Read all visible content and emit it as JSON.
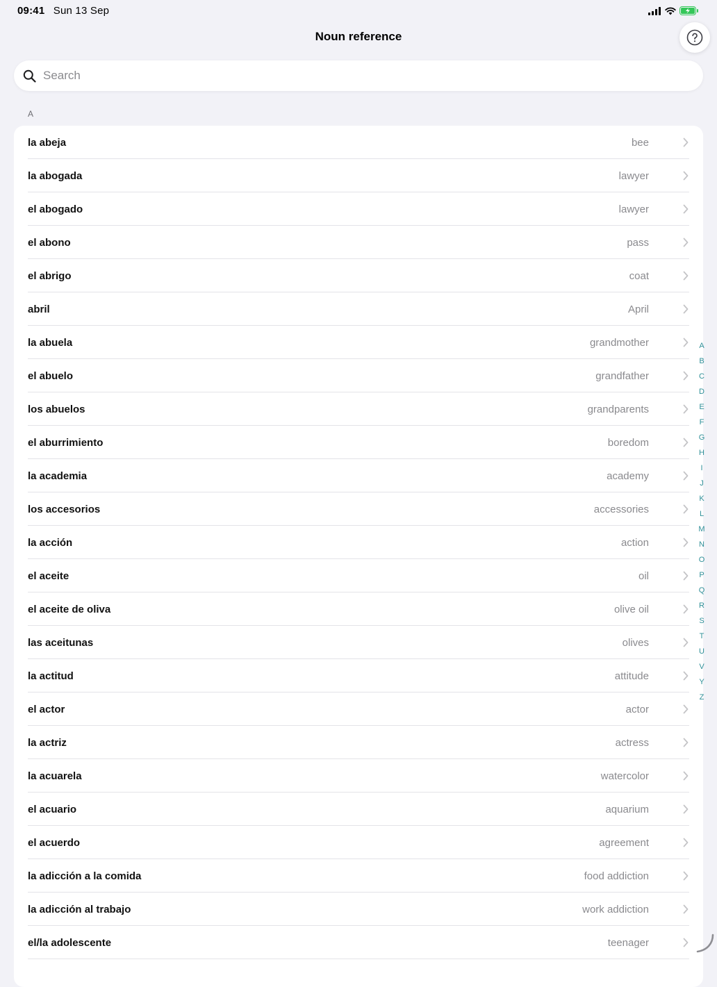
{
  "status": {
    "time": "09:41",
    "date": "Sun 13 Sep",
    "battery_color": "#34c759"
  },
  "nav": {
    "title": "Noun reference",
    "help_icon": "question-circle-icon"
  },
  "search": {
    "placeholder": "Search",
    "value": ""
  },
  "section": {
    "header": "A"
  },
  "rows": [
    {
      "term": "la abeja",
      "translation": "bee"
    },
    {
      "term": "la abogada",
      "translation": "lawyer"
    },
    {
      "term": "el abogado",
      "translation": "lawyer"
    },
    {
      "term": "el abono",
      "translation": "pass"
    },
    {
      "term": "el abrigo",
      "translation": "coat"
    },
    {
      "term": "abril",
      "translation": "April"
    },
    {
      "term": "la abuela",
      "translation": "grandmother"
    },
    {
      "term": "el abuelo",
      "translation": "grandfather"
    },
    {
      "term": "los abuelos",
      "translation": "grandparents"
    },
    {
      "term": "el aburrimiento",
      "translation": "boredom"
    },
    {
      "term": "la academia",
      "translation": "academy"
    },
    {
      "term": "los accesorios",
      "translation": "accessories"
    },
    {
      "term": "la acción",
      "translation": "action"
    },
    {
      "term": "el aceite",
      "translation": "oil"
    },
    {
      "term": "el aceite de oliva",
      "translation": "olive oil"
    },
    {
      "term": "las aceitunas",
      "translation": "olives"
    },
    {
      "term": "la actitud",
      "translation": "attitude"
    },
    {
      "term": "el actor",
      "translation": "actor"
    },
    {
      "term": "la actriz",
      "translation": "actress"
    },
    {
      "term": "la acuarela",
      "translation": "watercolor"
    },
    {
      "term": "el acuario",
      "translation": "aquarium"
    },
    {
      "term": "el acuerdo",
      "translation": "agreement"
    },
    {
      "term": "la adicción a la comida",
      "translation": "food addiction"
    },
    {
      "term": "la adicción al trabajo",
      "translation": "work addiction"
    },
    {
      "term": "el/la adolescente",
      "translation": "teenager"
    }
  ],
  "index": [
    "A",
    "B",
    "C",
    "D",
    "E",
    "F",
    "G",
    "H",
    "I",
    "J",
    "K",
    "L",
    "M",
    "N",
    "O",
    "P",
    "Q",
    "R",
    "S",
    "T",
    "U",
    "V",
    "Y",
    "Z"
  ],
  "colors": {
    "accent": "#2f8f98",
    "secondary_text": "#8a8a8e",
    "background": "#f2f2f7"
  }
}
